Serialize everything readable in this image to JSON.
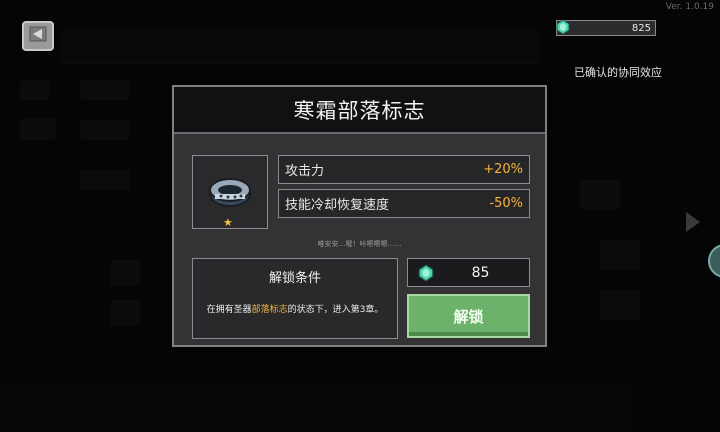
{
  "app": {
    "version": "Ver. 1.0.19"
  },
  "header": {
    "back_icon": "back-arrow-icon",
    "currency": {
      "icon": "gem-icon",
      "value": "825"
    },
    "synergy_label": "已确认的协同效应"
  },
  "modal": {
    "title": "寒霜部落标志",
    "item_icon": "frost-ring-icon",
    "rarity_icon": "star-icon",
    "rarity_symbol": "★",
    "stats": [
      {
        "label": "攻击力",
        "value": "+20%"
      },
      {
        "label": "技能冷却恢复速度",
        "value": "-50%"
      }
    ],
    "hint": "唯安安…喔！咔嚓嚓嚓……",
    "condition": {
      "title": "解锁条件",
      "desc_prefix": "在拥有圣器",
      "desc_highlight": "部落标志",
      "desc_suffix": "的状态下，进入第3章。"
    },
    "cost": {
      "icon": "gem-icon",
      "value": "85"
    },
    "unlock_button": "解锁"
  },
  "colors": {
    "accent_value": "#f2b43a",
    "unlock_button": "#6db26a",
    "gem": "#4fd3b0"
  }
}
